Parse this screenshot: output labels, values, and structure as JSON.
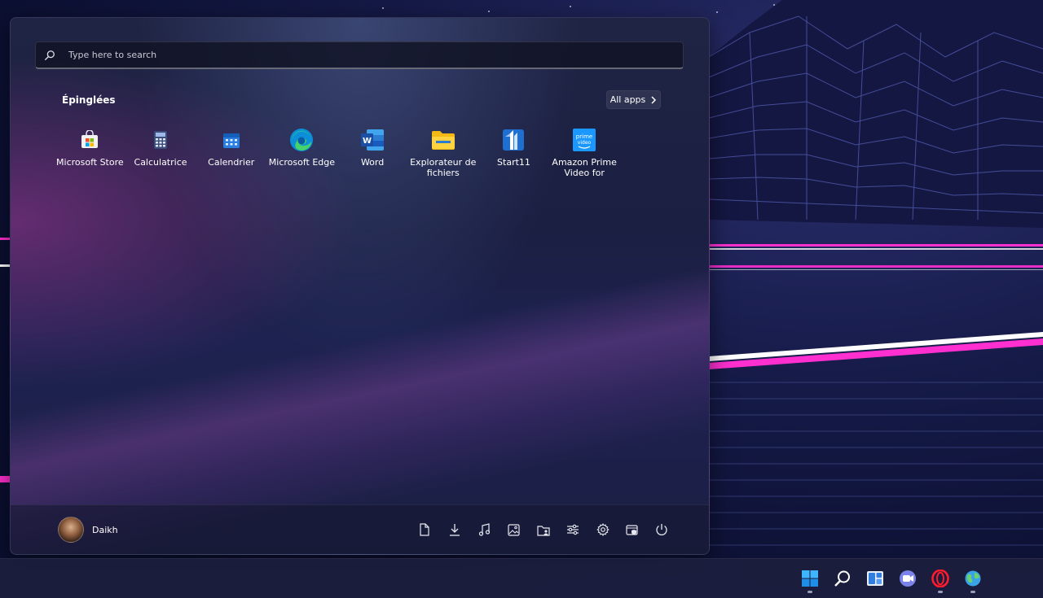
{
  "search": {
    "placeholder": "Type here to search"
  },
  "pinned": {
    "title": "Épinglées",
    "all_apps_label": "All apps",
    "apps": [
      {
        "label": "Microsoft Store",
        "icon": "microsoft-store-icon"
      },
      {
        "label": "Calculatrice",
        "icon": "calculator-icon"
      },
      {
        "label": "Calendrier",
        "icon": "calendar-icon"
      },
      {
        "label": "Microsoft Edge",
        "icon": "edge-icon"
      },
      {
        "label": "Word",
        "icon": "word-icon"
      },
      {
        "label": "Explorateur de fichiers",
        "icon": "file-explorer-icon"
      },
      {
        "label": "Start11",
        "icon": "start11-icon"
      },
      {
        "label": "Amazon Prime Video for",
        "icon": "prime-video-icon"
      }
    ]
  },
  "user": {
    "name": "Daikh"
  },
  "folders": [
    "documents-icon",
    "downloads-icon",
    "music-icon",
    "pictures-icon",
    "personal-folder-icon",
    "settings-sliders-icon",
    "gear-icon",
    "file-explorer-shield-icon",
    "power-icon"
  ],
  "taskbar": [
    "windows-start-icon",
    "search-icon",
    "widgets-icon",
    "teams-chat-icon",
    "opera-icon",
    "globe-icon"
  ],
  "colors": {
    "accent": "#ff2fd0",
    "neon_white": "#ffffff"
  }
}
